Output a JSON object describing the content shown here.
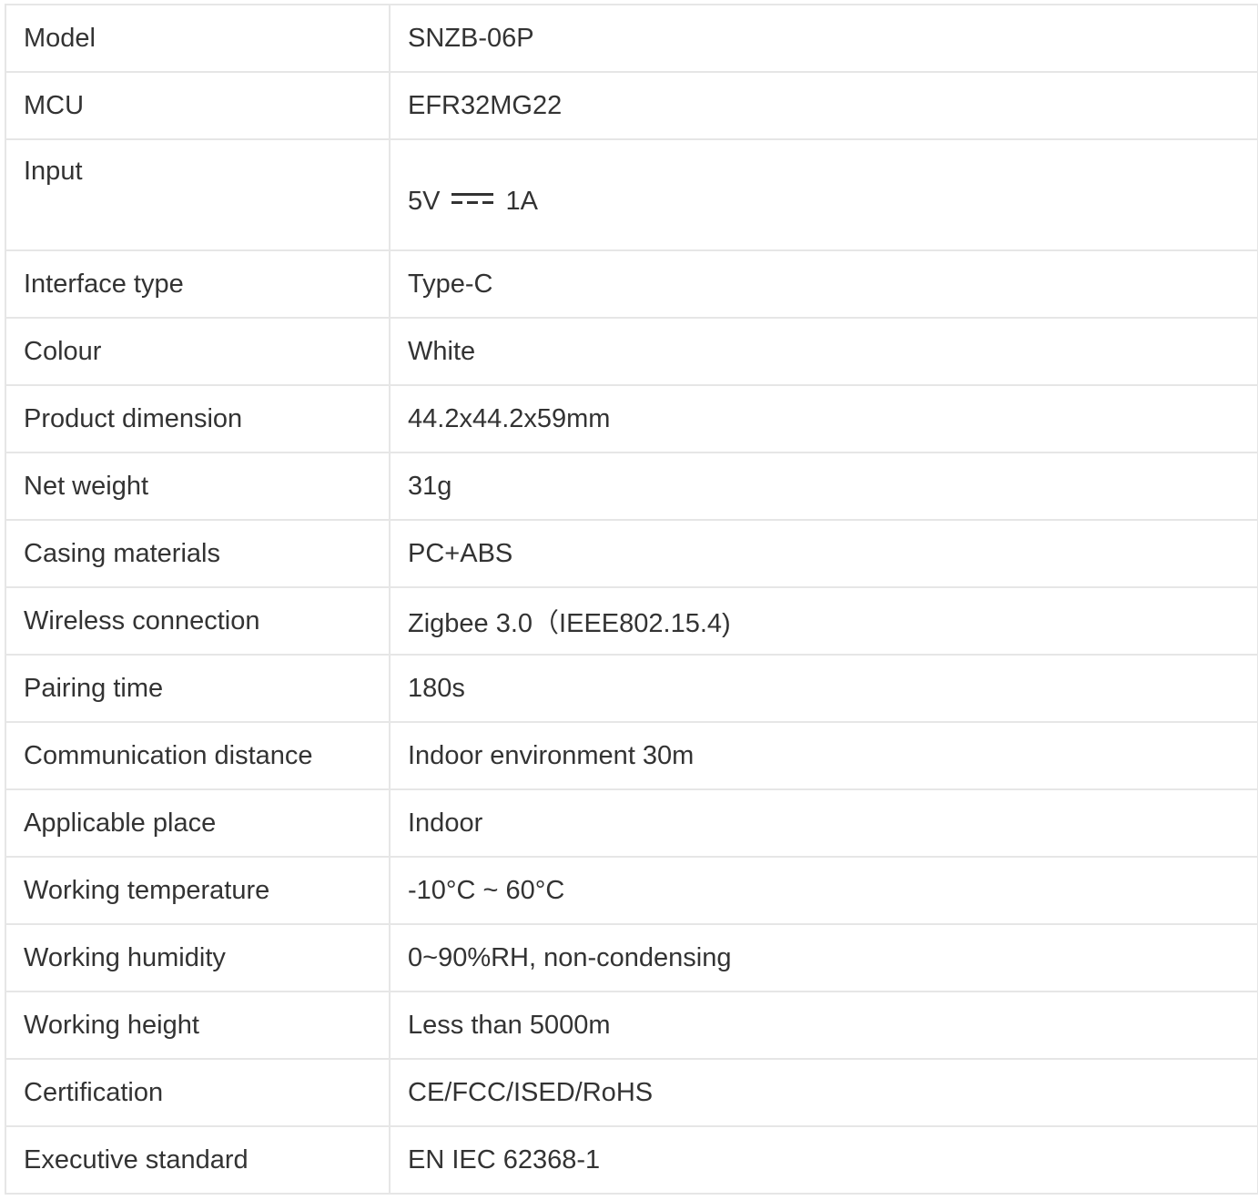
{
  "specs": [
    {
      "label": "Model",
      "value": "SNZB-06P"
    },
    {
      "label": "MCU",
      "value": "EFR32MG22"
    },
    {
      "label": "Input",
      "value": "5V",
      "value_suffix": "1A",
      "value_icon": "dc-current-symbol-icon"
    },
    {
      "label": "Interface type",
      "value": "Type-C"
    },
    {
      "label": "Colour",
      "value": "White"
    },
    {
      "label": "Product dimension",
      "value": "44.2x44.2x59mm"
    },
    {
      "label": "Net weight",
      "value": "31g"
    },
    {
      "label": "Casing materials",
      "value": "PC+ABS"
    },
    {
      "label": "Wireless connection",
      "value": "Zigbee 3.0（IEEE802.15.4)"
    },
    {
      "label": "Pairing time",
      "value": "180s"
    },
    {
      "label": "Communication distance",
      "value": "Indoor environment 30m"
    },
    {
      "label": "Applicable place",
      "value": "Indoor"
    },
    {
      "label": "Working temperature",
      "value": "-10°C ~ 60°C"
    },
    {
      "label": "Working humidity",
      "value": "0~90%RH, non-condensing"
    },
    {
      "label": "Working height",
      "value": "Less than 5000m"
    },
    {
      "label": "Certification",
      "value": "CE/FCC/ISED/RoHS"
    },
    {
      "label": "Executive standard",
      "value": "EN IEC 62368-1"
    }
  ],
  "colors": {
    "border": "#e6e6e6",
    "text": "#333333",
    "text_dark": "#111111",
    "background": "#ffffff"
  }
}
